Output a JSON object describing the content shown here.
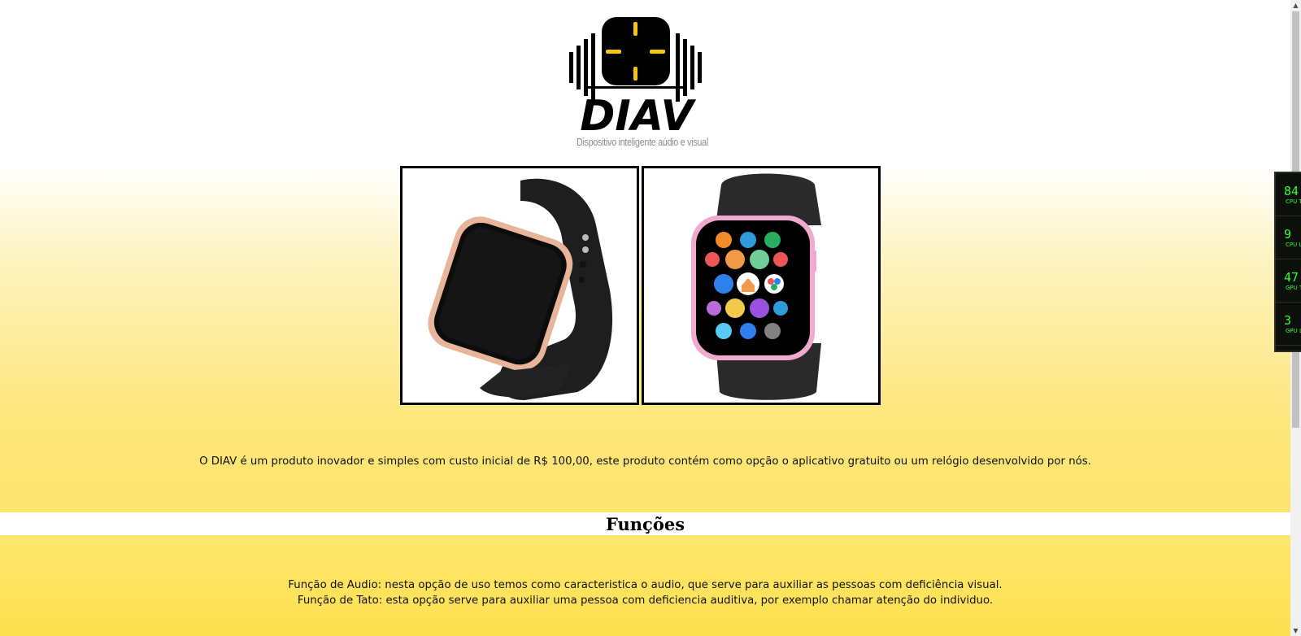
{
  "brand": {
    "name": "DIAV",
    "tagline": "Dispositivo inteligente aúdio e visual"
  },
  "gallery": {
    "items": [
      {
        "alt": "Relógio DIAV com pulseira preta e moldura rosé"
      },
      {
        "alt": "Relógio DIAV com tela de aplicativos e moldura rosa"
      }
    ]
  },
  "intro": {
    "text": "O DIAV é um produto inovador e simples com custo inicial de R$ 100,00, este produto contém como opção o aplicativo gratuito ou um relógio desenvolvido por nós."
  },
  "functions": {
    "title": "Funções",
    "items": [
      "Função de Audio: nesta opção de uso temos como caracteristica o audio, que serve para auxiliar as pessoas com deficiência visual.",
      "Função de Tato: esta opção serve para auxiliar uma pessoa com deficiencia auditiva, por exemplo chamar atenção do individuo."
    ]
  },
  "hardware_monitor": {
    "items": [
      {
        "value": "84",
        "label": "CPU T"
      },
      {
        "value": "9",
        "label": "CPU L"
      },
      {
        "value": "47",
        "label": "GPU T"
      },
      {
        "value": "3",
        "label": "GPU L"
      }
    ]
  },
  "colors": {
    "accent_yellow": "#fde046",
    "logo_black": "#000000",
    "logo_yellow": "#f5c518",
    "monitor_green": "#2dff2d"
  }
}
